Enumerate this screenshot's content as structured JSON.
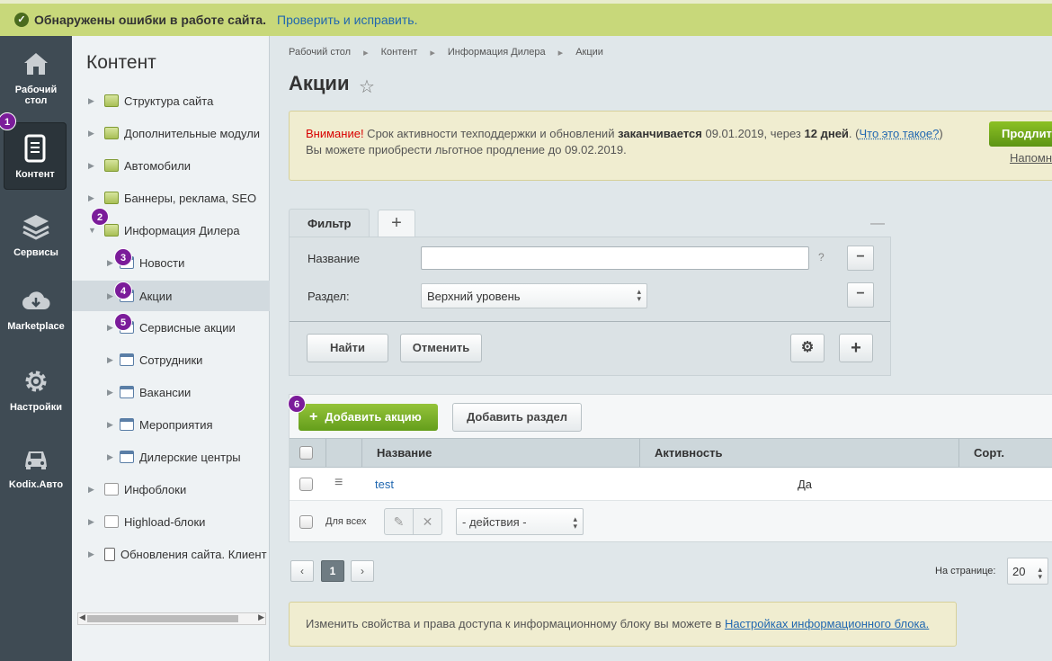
{
  "topbar": {
    "message": "Обнаружены ошибки в работе сайта.",
    "fix_link": "Проверить и исправить."
  },
  "left_menu": {
    "items": [
      {
        "label": "Рабочий стол",
        "icon": "home-icon"
      },
      {
        "label": "Контент",
        "icon": "document-icon"
      },
      {
        "label": "Сервисы",
        "icon": "layers-icon"
      },
      {
        "label": "Marketplace",
        "icon": "cloud-icon"
      },
      {
        "label": "Настройки",
        "icon": "gear-icon"
      },
      {
        "label": "Kodix.Авто",
        "icon": "car-icon"
      }
    ]
  },
  "tree": {
    "title": "Контент",
    "items": [
      {
        "label": "Структура сайта"
      },
      {
        "label": "Дополнительные модули"
      },
      {
        "label": "Автомобили"
      },
      {
        "label": "Баннеры, реклама, SEO"
      },
      {
        "label": "Информация Дилера"
      },
      {
        "label": "Новости"
      },
      {
        "label": "Акции"
      },
      {
        "label": "Сервисные акции"
      },
      {
        "label": "Сотрудники"
      },
      {
        "label": "Вакансии"
      },
      {
        "label": "Мероприятия"
      },
      {
        "label": "Дилерские центры"
      },
      {
        "label": "Инфоблоки"
      },
      {
        "label": "Highload-блоки"
      },
      {
        "label": "Обновления сайта. Клиент"
      }
    ]
  },
  "badges": [
    "1",
    "2",
    "3",
    "4",
    "5",
    "6"
  ],
  "breadcrumbs": [
    "Рабочий стол",
    "Контент",
    "Информация Дилера",
    "Акции"
  ],
  "page": {
    "title": "Акции",
    "star": "☆"
  },
  "warning": {
    "attention": "Внимание!",
    "text1": " Срок активности техподдержки и обновлений ",
    "ends": "заканчивается",
    "date": " 09.01.2019, через ",
    "days": "12 дней",
    "dot": ". (",
    "what": "Что это такое?",
    "close": ")",
    "line2": "Вы можете приобрести льготное продление до 09.02.2019.",
    "prolong_btn": "Продлить",
    "remind": "Напомнить"
  },
  "filter": {
    "tab": "Фильтр",
    "add_tab": "+",
    "minimize": "—",
    "name_label": "Название",
    "name_value": "",
    "help": "?",
    "section_label": "Раздел:",
    "section_value": "Верхний уровень",
    "find_btn": "Найти",
    "cancel_btn": "Отменить"
  },
  "table": {
    "add_btn": "Добавить акцию",
    "add_section_btn": "Добавить раздел",
    "columns": [
      "Название",
      "Активность",
      "Сорт."
    ],
    "rows": [
      {
        "name": "test",
        "active": "Да"
      }
    ],
    "for_all": "Для всех",
    "actions": "- действия -"
  },
  "pagination": {
    "prev": "‹",
    "current": "1",
    "next": "›",
    "per_page_label": "На странице:",
    "per_page": "20"
  },
  "note": {
    "text": "Изменить свойства и права доступа к информационному блоку вы можете в ",
    "link": "Настройках информационного блока."
  }
}
